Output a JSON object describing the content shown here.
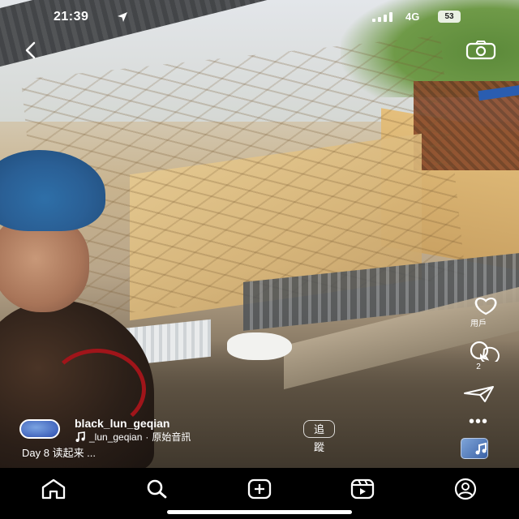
{
  "status_bar": {
    "time": "21:39",
    "network": "4G",
    "battery": "53",
    "icons": [
      "location-arrow-icon",
      "signal-bars-icon"
    ]
  },
  "top_bar": {
    "icons": [
      "back-chevron-icon",
      "camera-icon"
    ]
  },
  "side_actions": {
    "likes_label": "用戶",
    "comments_count": "2",
    "icons": [
      "heart-icon",
      "comment-icon",
      "share-icon",
      "more-icon"
    ]
  },
  "reel": {
    "username": "black_lun_geqian",
    "audio_author": "_lun_geqian",
    "audio_separator": "·",
    "audio_title": "原始音訊",
    "follow_label": "追蹤",
    "caption": "Day 8 读起来 ..."
  },
  "bottom_nav": {
    "items": [
      "home-icon",
      "search-icon",
      "create-icon",
      "reels-icon",
      "profile-icon"
    ]
  },
  "colors": {
    "nav_background": "#000000",
    "overlay_text": "#ffffff"
  }
}
